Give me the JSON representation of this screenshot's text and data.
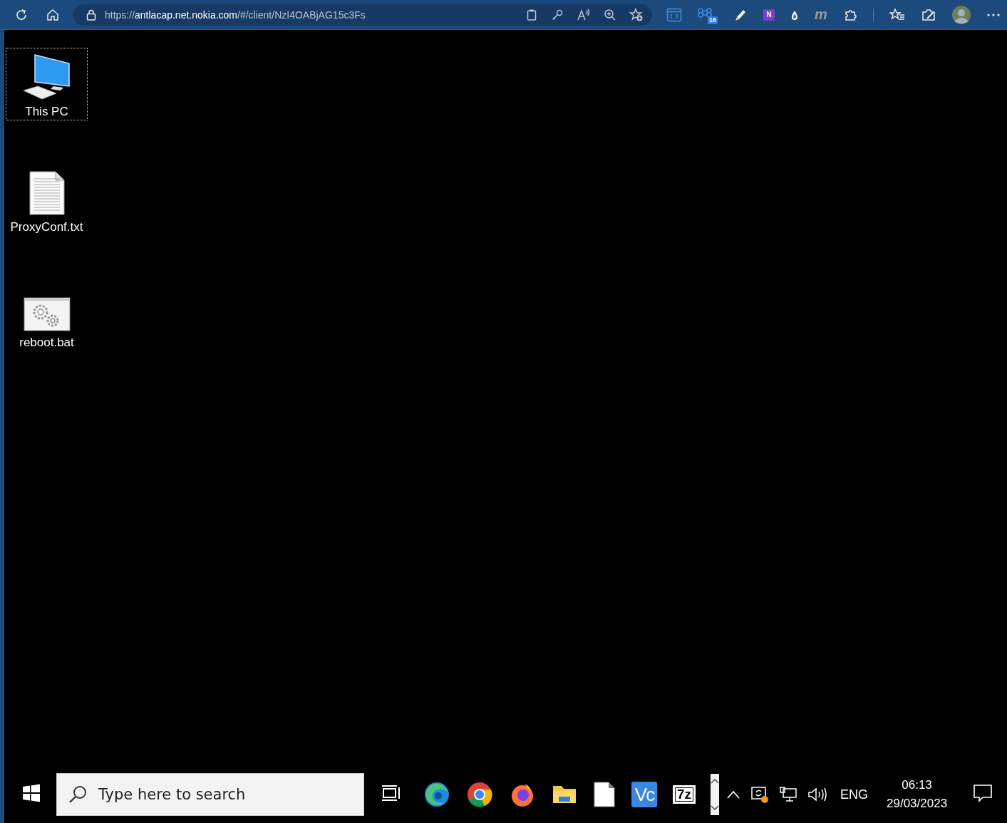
{
  "browser": {
    "address": "https://**antlacap.net.nokia.com**/#/client/NzI4OABjAG15c3Fs",
    "address_actions": [
      {
        "kind": "clipboard"
      },
      {
        "kind": "key"
      },
      {
        "kind": "read-aloud"
      },
      {
        "kind": "zoom"
      },
      {
        "kind": "add-favorite"
      }
    ],
    "extensions": [
      {
        "kind": "code"
      },
      {
        "kind": "command",
        "badge": "16"
      },
      {
        "kind": "highlighter"
      },
      {
        "kind": "notebook",
        "label": "N"
      },
      {
        "kind": "drop"
      },
      {
        "kind": "letter",
        "label": "m"
      },
      {
        "kind": "puzzle"
      }
    ],
    "tools": [
      {
        "kind": "favorites"
      },
      {
        "kind": "screenshot"
      },
      {
        "kind": "avatar"
      },
      {
        "kind": "more"
      }
    ]
  },
  "desktop": {
    "icons": [
      {
        "kind": "computer",
        "label": "This PC",
        "selected": true
      },
      {
        "kind": "text-file",
        "label": "ProxyConf.txt",
        "selected": false
      },
      {
        "kind": "batch-file",
        "label": "reboot.bat",
        "selected": false
      }
    ]
  },
  "taskbar": {
    "search": {
      "placeholder": "Type here to search"
    },
    "apps": [
      {
        "kind": "edge"
      },
      {
        "kind": "chrome"
      },
      {
        "kind": "firefox"
      },
      {
        "kind": "folder"
      },
      {
        "kind": "document"
      },
      {
        "kind": "vnc",
        "label": "Vc"
      },
      {
        "kind": "archive",
        "label": "7z"
      }
    ],
    "tray": {
      "language": "ENG",
      "time": "06:13",
      "date": "29/03/2023"
    }
  }
}
